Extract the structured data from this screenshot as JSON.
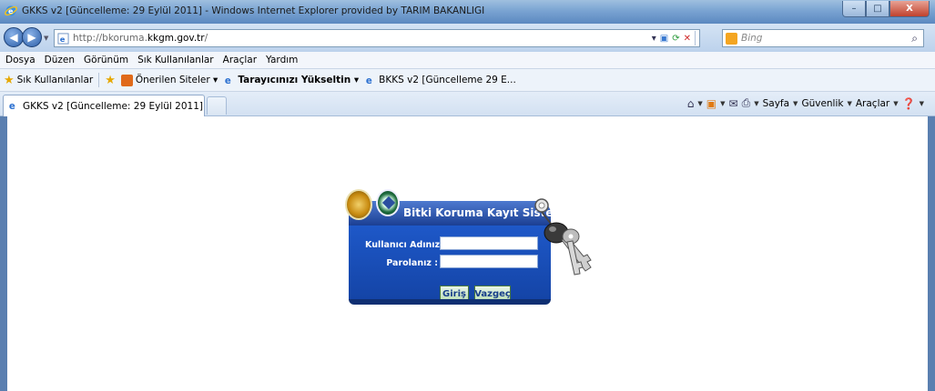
{
  "window": {
    "title": "GKKS v2 [Güncelleme: 29 Eylül 2011] - Windows Internet Explorer provided by TARIM BAKANLIGI",
    "minimize_label": "–",
    "maximize_label": "□",
    "close_label": "X"
  },
  "address": {
    "url_prefix": "http://bkoruma.",
    "url_domain": "kkgm.gov.tr",
    "url_suffix": "/"
  },
  "search": {
    "placeholder": "Bing"
  },
  "menu": [
    "Dosya",
    "Düzen",
    "Görünüm",
    "Sık Kullanılanlar",
    "Araçlar",
    "Yardım"
  ],
  "favorites": {
    "label": "Sık Kullanılanlar",
    "items": [
      "Önerilen Siteler ▾",
      "Tarayıcınızı Yükseltin ▾",
      "BKKS v2 [Güncelleme 29 E..."
    ]
  },
  "tabs": [
    {
      "label": "GKKS v2 [Güncelleme: 29 Eylül 2011]"
    }
  ],
  "commandbar": {
    "page_label": "Sayfa",
    "safety_label": "Güvenlik",
    "tools_label": "Araçlar"
  },
  "login": {
    "title": "Bitki Koruma Kayıt Sistemi",
    "username_label": "Kullanıcı Adınız :",
    "password_label": "Parolanız :",
    "username_value": "",
    "password_value": "",
    "login_button": "Giriş",
    "cancel_button": "Vazgeç"
  }
}
